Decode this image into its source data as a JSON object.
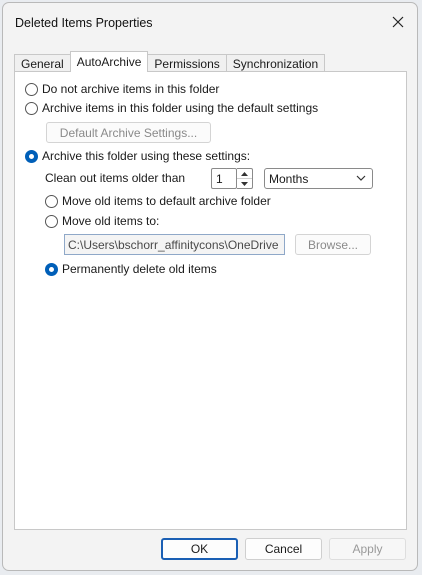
{
  "window": {
    "title": "Deleted Items Properties",
    "close_icon": "close-icon"
  },
  "tabs": [
    {
      "label": "General",
      "active": false
    },
    {
      "label": "AutoArchive",
      "active": true
    },
    {
      "label": "Permissions",
      "active": false
    },
    {
      "label": "Synchronization",
      "active": false
    }
  ],
  "autoarchive": {
    "option_do_not_archive": "Do not archive items in this folder",
    "option_default_settings": "Archive items in this folder using the default settings",
    "default_settings_button": "Default Archive Settings...",
    "option_these_settings": "Archive this folder using these settings:",
    "selected_option": "these_settings",
    "clean_out_label": "Clean out items older than",
    "clean_out_value": "1",
    "clean_out_unit": "Months",
    "move_default_label": "Move old items to default archive folder",
    "move_to_label": "Move old items to:",
    "move_to_path": "C:\\Users\\bschorr_affinitycons\\OneDrive",
    "browse_button": "Browse...",
    "permanently_delete_label": "Permanently delete old items",
    "selected_action": "permanently_delete"
  },
  "footer": {
    "ok_label": "OK",
    "cancel_label": "Cancel",
    "apply_label": "Apply"
  },
  "colors": {
    "accent": "#005fb8",
    "panel_bg": "#ffffff",
    "window_bg": "#f3f3f3"
  }
}
